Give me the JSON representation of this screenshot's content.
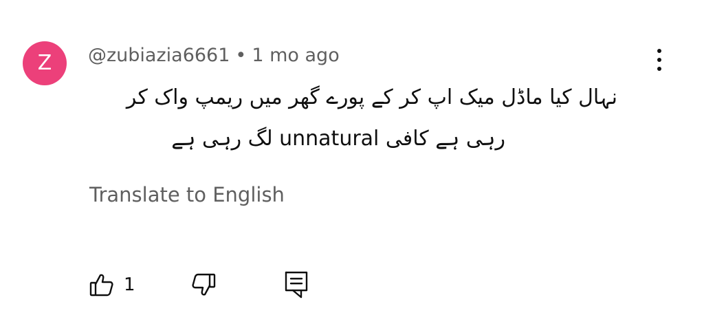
{
  "comment": {
    "avatar_letter": "Z",
    "avatar_color": "#ec407a",
    "username": "@zubiazia6661",
    "separator": "•",
    "timestamp": "1 mo ago",
    "text_line_1": "نہال کیا ماڈل میک اپ کر کے پورے گھر میں  ریمپ واک کر",
    "text_line_2": "رہی ہے کافی unnatural لگ رہی ہے",
    "translate_label": "Translate to English",
    "like_count": "1"
  },
  "icons": {
    "like": "thumbs-up-icon",
    "dislike": "thumbs-down-icon",
    "reply": "reply-comment-icon",
    "more": "more-vertical-icon"
  }
}
